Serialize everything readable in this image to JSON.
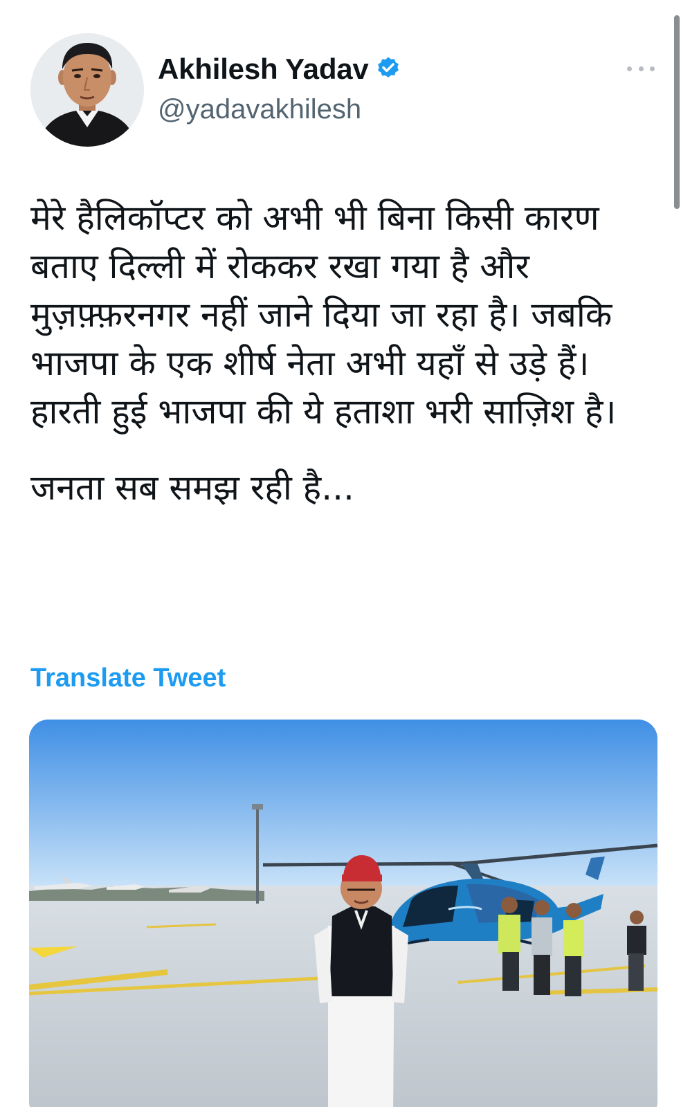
{
  "tweet": {
    "author": {
      "display_name": "Akhilesh Yadav",
      "handle": "@yadavakhilesh",
      "verified": true
    },
    "body_paragraphs": [
      "मेरे हैलिकॉप्टर को अभी भी बिना किसी कारण बताए दिल्ली में रोककर रखा गया है और मुज़फ़्फ़रनगर नहीं जाने दिया जा रहा है। जबकि भाजपा के एक शीर्ष नेता अभी यहाँ से उड़े हैं। हारती हुई भाजपा की ये हताशा भरी साज़िश है।",
      "जनता सब समझ रही है..."
    ],
    "translate_label": "Translate Tweet",
    "media": {
      "type": "photo"
    }
  },
  "icons": {
    "verified": "verified-badge-icon",
    "more": "more-options-icon"
  },
  "colors": {
    "link_blue": "#1d9bf0",
    "text_primary": "#0f1419",
    "text_secondary": "#536471",
    "verified_blue": "#1d9bf0"
  }
}
